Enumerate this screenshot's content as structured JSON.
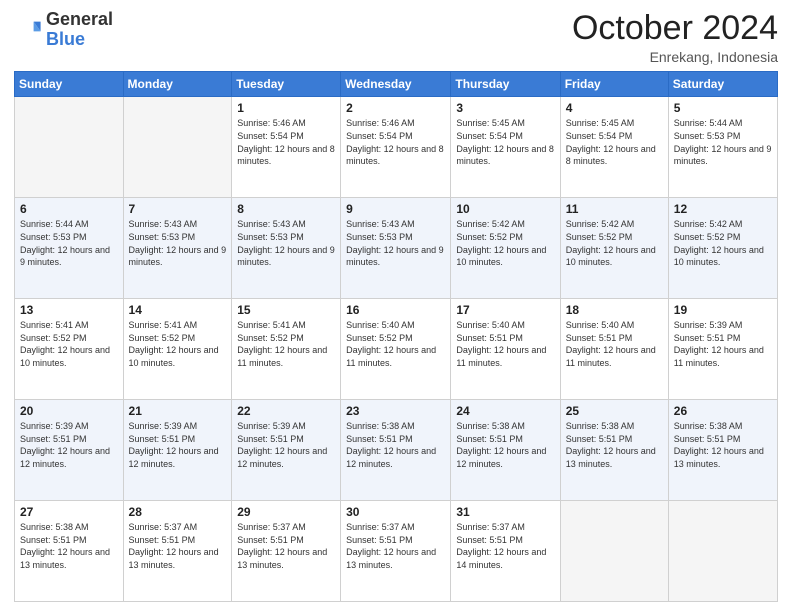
{
  "header": {
    "logo_general": "General",
    "logo_blue": "Blue",
    "month_title": "October 2024",
    "location": "Enrekang, Indonesia"
  },
  "days_of_week": [
    "Sunday",
    "Monday",
    "Tuesday",
    "Wednesday",
    "Thursday",
    "Friday",
    "Saturday"
  ],
  "weeks": [
    {
      "alt": false,
      "days": [
        {
          "num": "",
          "info": ""
        },
        {
          "num": "",
          "info": ""
        },
        {
          "num": "1",
          "info": "Sunrise: 5:46 AM\nSunset: 5:54 PM\nDaylight: 12 hours and 8 minutes."
        },
        {
          "num": "2",
          "info": "Sunrise: 5:46 AM\nSunset: 5:54 PM\nDaylight: 12 hours and 8 minutes."
        },
        {
          "num": "3",
          "info": "Sunrise: 5:45 AM\nSunset: 5:54 PM\nDaylight: 12 hours and 8 minutes."
        },
        {
          "num": "4",
          "info": "Sunrise: 5:45 AM\nSunset: 5:54 PM\nDaylight: 12 hours and 8 minutes."
        },
        {
          "num": "5",
          "info": "Sunrise: 5:44 AM\nSunset: 5:53 PM\nDaylight: 12 hours and 9 minutes."
        }
      ]
    },
    {
      "alt": true,
      "days": [
        {
          "num": "6",
          "info": "Sunrise: 5:44 AM\nSunset: 5:53 PM\nDaylight: 12 hours and 9 minutes."
        },
        {
          "num": "7",
          "info": "Sunrise: 5:43 AM\nSunset: 5:53 PM\nDaylight: 12 hours and 9 minutes."
        },
        {
          "num": "8",
          "info": "Sunrise: 5:43 AM\nSunset: 5:53 PM\nDaylight: 12 hours and 9 minutes."
        },
        {
          "num": "9",
          "info": "Sunrise: 5:43 AM\nSunset: 5:53 PM\nDaylight: 12 hours and 9 minutes."
        },
        {
          "num": "10",
          "info": "Sunrise: 5:42 AM\nSunset: 5:52 PM\nDaylight: 12 hours and 10 minutes."
        },
        {
          "num": "11",
          "info": "Sunrise: 5:42 AM\nSunset: 5:52 PM\nDaylight: 12 hours and 10 minutes."
        },
        {
          "num": "12",
          "info": "Sunrise: 5:42 AM\nSunset: 5:52 PM\nDaylight: 12 hours and 10 minutes."
        }
      ]
    },
    {
      "alt": false,
      "days": [
        {
          "num": "13",
          "info": "Sunrise: 5:41 AM\nSunset: 5:52 PM\nDaylight: 12 hours and 10 minutes."
        },
        {
          "num": "14",
          "info": "Sunrise: 5:41 AM\nSunset: 5:52 PM\nDaylight: 12 hours and 10 minutes."
        },
        {
          "num": "15",
          "info": "Sunrise: 5:41 AM\nSunset: 5:52 PM\nDaylight: 12 hours and 11 minutes."
        },
        {
          "num": "16",
          "info": "Sunrise: 5:40 AM\nSunset: 5:52 PM\nDaylight: 12 hours and 11 minutes."
        },
        {
          "num": "17",
          "info": "Sunrise: 5:40 AM\nSunset: 5:51 PM\nDaylight: 12 hours and 11 minutes."
        },
        {
          "num": "18",
          "info": "Sunrise: 5:40 AM\nSunset: 5:51 PM\nDaylight: 12 hours and 11 minutes."
        },
        {
          "num": "19",
          "info": "Sunrise: 5:39 AM\nSunset: 5:51 PM\nDaylight: 12 hours and 11 minutes."
        }
      ]
    },
    {
      "alt": true,
      "days": [
        {
          "num": "20",
          "info": "Sunrise: 5:39 AM\nSunset: 5:51 PM\nDaylight: 12 hours and 12 minutes."
        },
        {
          "num": "21",
          "info": "Sunrise: 5:39 AM\nSunset: 5:51 PM\nDaylight: 12 hours and 12 minutes."
        },
        {
          "num": "22",
          "info": "Sunrise: 5:39 AM\nSunset: 5:51 PM\nDaylight: 12 hours and 12 minutes."
        },
        {
          "num": "23",
          "info": "Sunrise: 5:38 AM\nSunset: 5:51 PM\nDaylight: 12 hours and 12 minutes."
        },
        {
          "num": "24",
          "info": "Sunrise: 5:38 AM\nSunset: 5:51 PM\nDaylight: 12 hours and 12 minutes."
        },
        {
          "num": "25",
          "info": "Sunrise: 5:38 AM\nSunset: 5:51 PM\nDaylight: 12 hours and 13 minutes."
        },
        {
          "num": "26",
          "info": "Sunrise: 5:38 AM\nSunset: 5:51 PM\nDaylight: 12 hours and 13 minutes."
        }
      ]
    },
    {
      "alt": false,
      "days": [
        {
          "num": "27",
          "info": "Sunrise: 5:38 AM\nSunset: 5:51 PM\nDaylight: 12 hours and 13 minutes."
        },
        {
          "num": "28",
          "info": "Sunrise: 5:37 AM\nSunset: 5:51 PM\nDaylight: 12 hours and 13 minutes."
        },
        {
          "num": "29",
          "info": "Sunrise: 5:37 AM\nSunset: 5:51 PM\nDaylight: 12 hours and 13 minutes."
        },
        {
          "num": "30",
          "info": "Sunrise: 5:37 AM\nSunset: 5:51 PM\nDaylight: 12 hours and 13 minutes."
        },
        {
          "num": "31",
          "info": "Sunrise: 5:37 AM\nSunset: 5:51 PM\nDaylight: 12 hours and 14 minutes."
        },
        {
          "num": "",
          "info": ""
        },
        {
          "num": "",
          "info": ""
        }
      ]
    }
  ]
}
